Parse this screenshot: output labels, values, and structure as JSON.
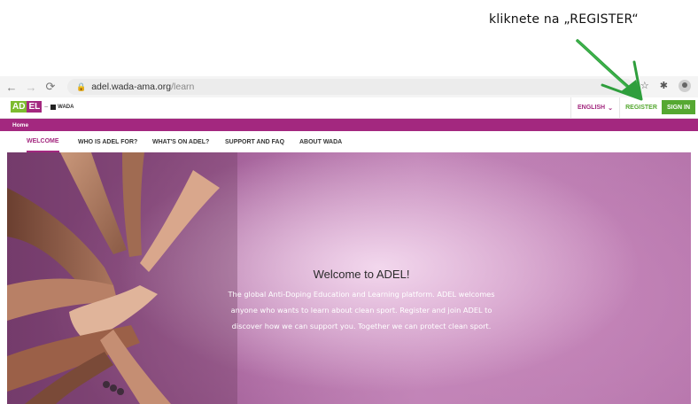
{
  "annotation": {
    "text": "kliknete na „REGISTER“"
  },
  "browser": {
    "url_domain": "adel.wada-ama.org",
    "url_path": "/learn",
    "back_icon": "back-arrow-icon",
    "forward_icon": "forward-arrow-icon",
    "reload_icon": "reload-icon"
  },
  "header": {
    "logo_ad": "AD",
    "logo_el": "EL",
    "logo_wada": "WADA",
    "language": "ENGLISH",
    "register": "REGISTER",
    "sign_in": "SIGN IN"
  },
  "breadcrumb": {
    "home": "Home"
  },
  "nav": {
    "items": [
      {
        "label": "WELCOME",
        "active": true
      },
      {
        "label": "WHO IS ADEL FOR?"
      },
      {
        "label": "WHAT'S ON ADEL?"
      },
      {
        "label": "SUPPORT AND FAQ"
      },
      {
        "label": "ABOUT WADA"
      }
    ]
  },
  "hero": {
    "title": "Welcome to ADEL!",
    "line1": "The global Anti-Doping Education and Learning platform. ADEL welcomes",
    "line2": "anyone who wants to learn about clean sport. Register and join ADEL to",
    "line3": "discover how we can support you. Together we can protect clean sport."
  },
  "colors": {
    "brand_purple": "#a3287f",
    "brand_green": "#55a831",
    "arrow_green": "#2e9e3c"
  }
}
